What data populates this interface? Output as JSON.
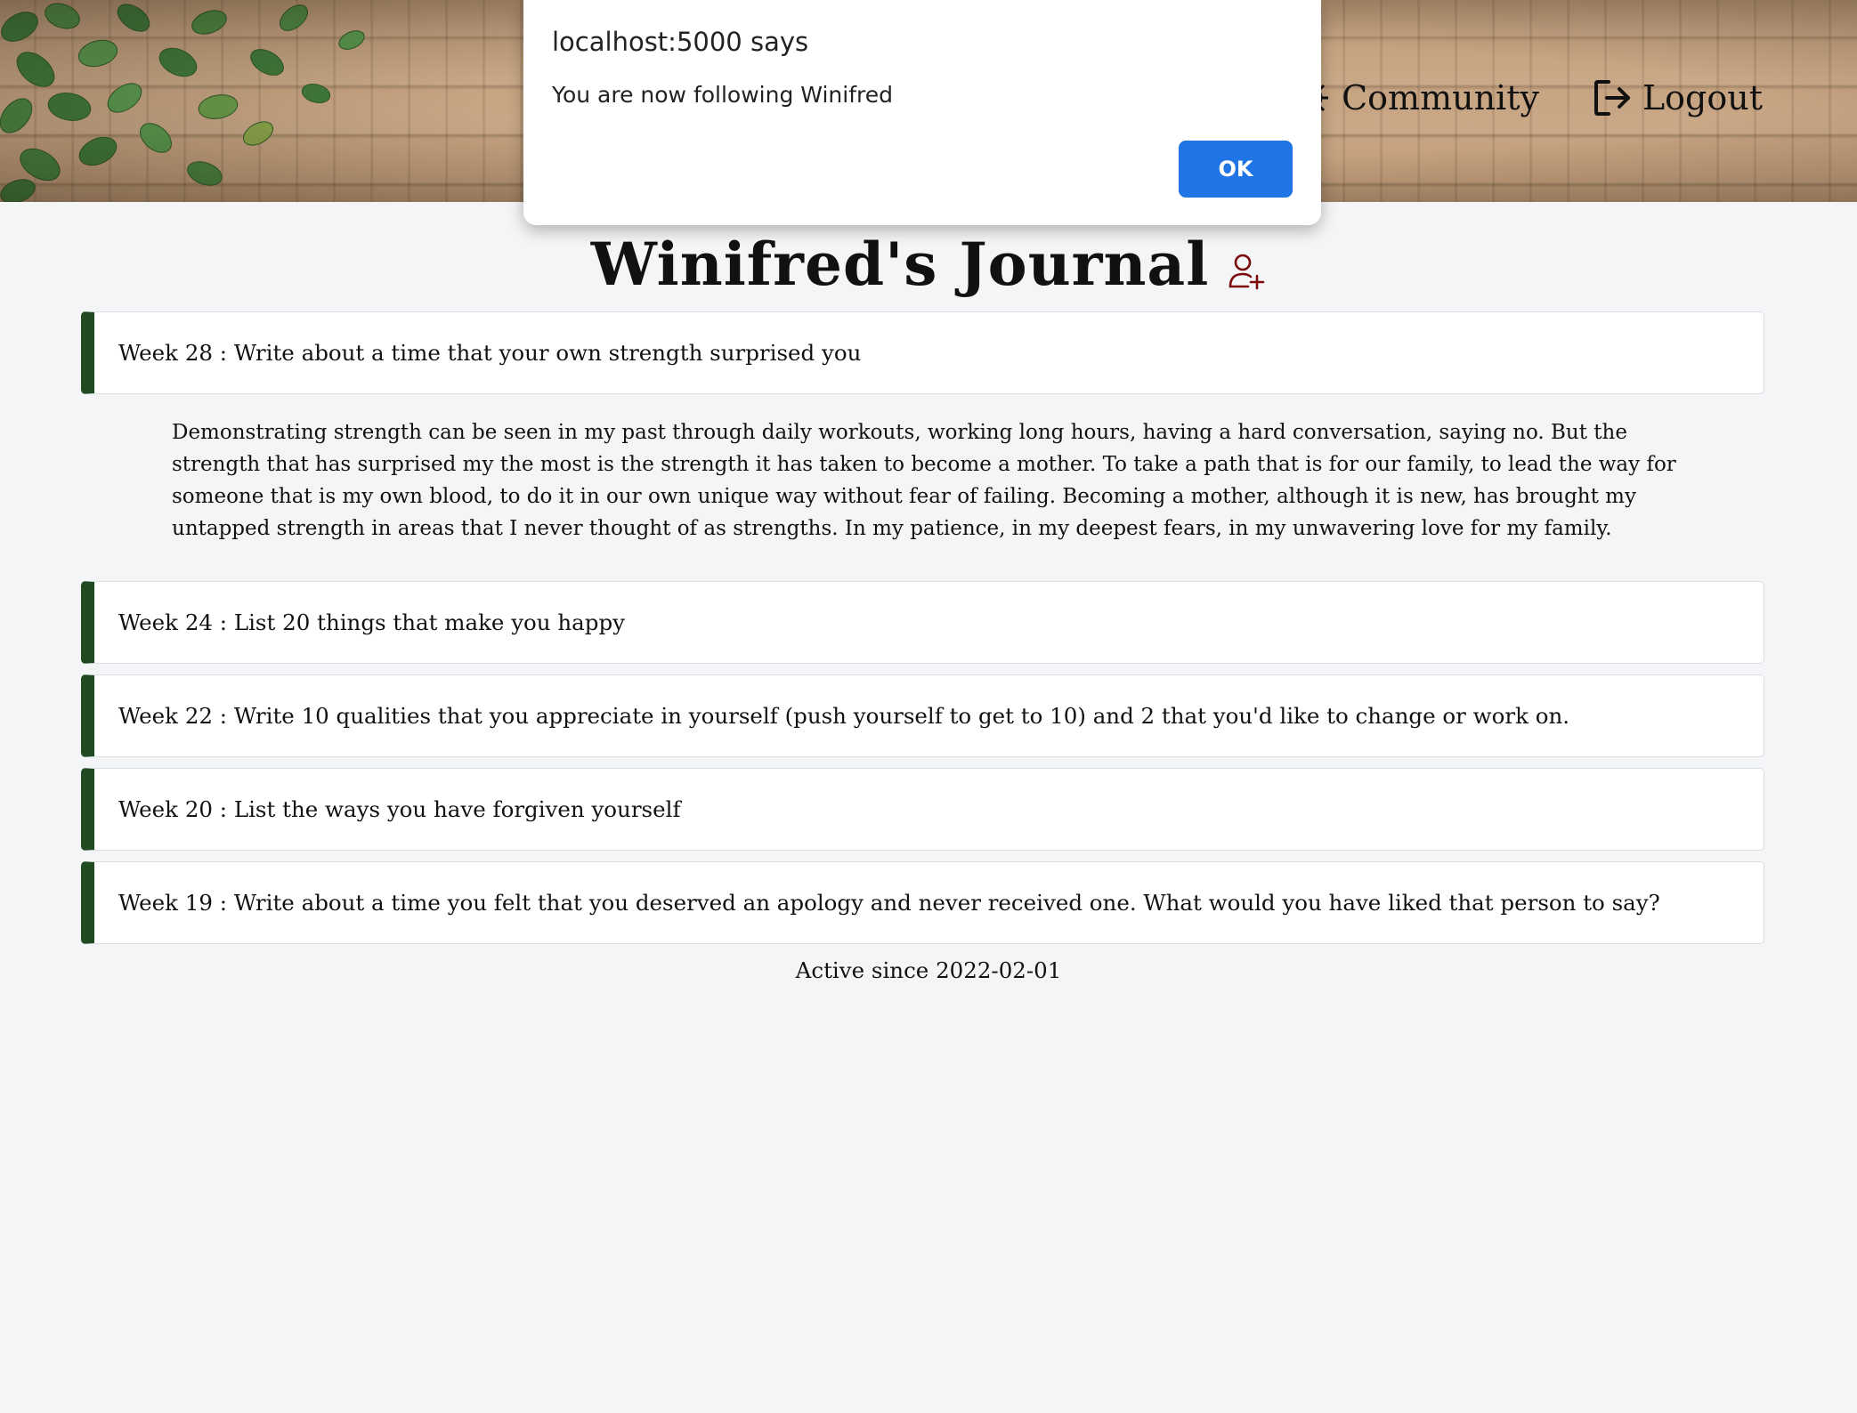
{
  "header": {
    "nav": [
      {
        "label": "Community",
        "icon": "community-icon"
      },
      {
        "label": "Logout",
        "icon": "logout-icon"
      }
    ]
  },
  "dialog": {
    "title": "localhost:5000 says",
    "message": "You are now following Winifred",
    "ok_label": "OK"
  },
  "journal": {
    "title": "Winifred's Journal",
    "follow_icon": "user-plus-icon",
    "accent_color": "#1f4a22",
    "entries": [
      {
        "label": "Week 28 : Write about a time that your own strength surprised you",
        "expanded": true,
        "body": "Demonstrating strength can be seen in my past through daily workouts, working long hours, having a hard conversation, saying no. But the strength that has surprised my the most is the strength it has taken to become a mother. To take a path that is for our family, to lead the way for someone that is my own blood, to do it in our own unique way without fear of failing. Becoming a mother, although it is new, has brought my untapped strength in areas that I never thought of as strengths. In my patience, in my deepest fears, in my unwavering love for my family."
      },
      {
        "label": "Week 24 : List 20 things that make you happy",
        "expanded": false
      },
      {
        "label": "Week 22 : Write 10 qualities that you appreciate in yourself (push yourself to get to 10) and 2 that you'd like to change or work on.",
        "expanded": false
      },
      {
        "label": "Week 20 : List the ways you have forgiven yourself",
        "expanded": false
      },
      {
        "label": "Week 19 : Write about a time you felt that you deserved an apology and never received one. What would you have liked that person to say?",
        "expanded": false
      }
    ],
    "active_since": "Active since 2022-02-01"
  }
}
